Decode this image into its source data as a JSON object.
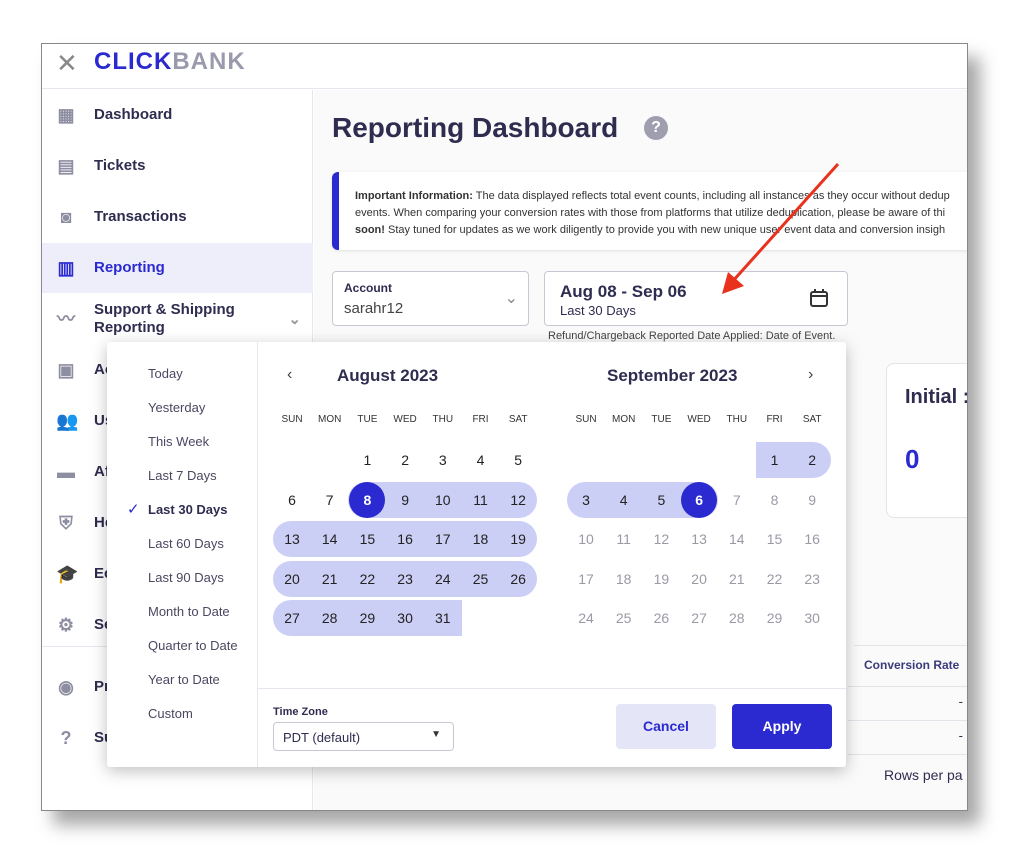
{
  "header": {
    "close_icon": "close-icon",
    "logo": "CLICKBANK"
  },
  "sidebar": {
    "items": [
      {
        "label": "Dashboard",
        "icon": "grid-icon"
      },
      {
        "label": "Tickets",
        "icon": "clipboard-icon"
      },
      {
        "label": "Transactions",
        "icon": "receipt-search-icon"
      },
      {
        "label": "Reporting",
        "icon": "bar-chart-icon",
        "active": true
      },
      {
        "label": "Support & Shipping Reporting",
        "icon": "trend-line-icon"
      },
      {
        "label": "Ac",
        "icon": "badge-icon"
      },
      {
        "label": "Us",
        "icon": "users-icon"
      },
      {
        "label": "Af",
        "icon": "store-icon"
      },
      {
        "label": "He",
        "icon": "shield-link-icon"
      },
      {
        "label": "Ec",
        "icon": "graduation-cap-icon"
      },
      {
        "label": "Se",
        "icon": "gear-icon"
      },
      {
        "label": "Pr",
        "icon": "user-circle-icon"
      },
      {
        "label": "Su",
        "icon": "question-circle-icon"
      }
    ]
  },
  "main": {
    "title": "Reporting Dashboard",
    "info": {
      "bold1": "Important Information:",
      "line1": " The data displayed reflects total event counts, including all instances as they occur without dedup",
      "line2": "events. When comparing your conversion rates with those from platforms that utilize deduplication, please be aware of thi",
      "bold3": "soon!",
      "line3": " Stay tuned for updates as we work diligently to provide you with new unique user event data and conversion insigh"
    },
    "account": {
      "label": "Account",
      "value": "sarahr12"
    },
    "date_range": {
      "value": "Aug 08 - Sep 06",
      "sub": "Last 30 Days",
      "note": "Refund/Chargeback Reported Date Applied: Date of Event."
    },
    "card": {
      "title": "Initial :",
      "value": "0"
    },
    "table": {
      "header": "Conversion Rate",
      "rows": [
        "-",
        "-"
      ],
      "rows_per_page": "Rows per pa"
    }
  },
  "picker": {
    "presets": [
      "Today",
      "Yesterday",
      "This Week",
      "Last 7 Days",
      "Last 30 Days",
      "Last 60 Days",
      "Last 90 Days",
      "Month to Date",
      "Quarter to Date",
      "Year to Date",
      "Custom"
    ],
    "selected_preset": "Last 30 Days",
    "weekdays": [
      "SUN",
      "MON",
      "TUE",
      "WED",
      "THU",
      "FRI",
      "SAT"
    ],
    "months": [
      {
        "title": "August 2023",
        "first_weekday": 2,
        "days": 31,
        "month": 8
      },
      {
        "title": "September 2023",
        "first_weekday": 5,
        "days": 30,
        "month": 9
      }
    ],
    "range_start": "2023-08-08",
    "range_end": "2023-09-06",
    "timezone_label": "Time Zone",
    "timezone": "PDT (default)",
    "cancel": "Cancel",
    "apply": "Apply"
  },
  "colors": {
    "accent": "#2a2ad0",
    "range": "#cbcff5",
    "annotation_arrow": "#e8321e"
  }
}
